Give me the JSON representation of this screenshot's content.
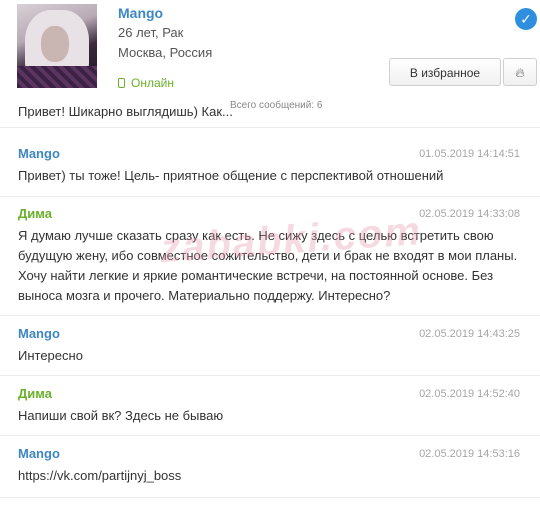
{
  "profile": {
    "name": "Mango",
    "age_sign": "26 лет, Рак",
    "location": "Москва, Россия",
    "status": "Онлайн",
    "favorite_button": "В избранное",
    "verified_icon": "check-circle-icon",
    "fire_icon": "fire-icon"
  },
  "total_messages": "Всего сообщений: 6",
  "watermark": "zababki.com",
  "first_message_partial": "Привет! Шикарно выглядишь) Как...",
  "messages": [
    {
      "author": "Mango",
      "time": "01.05.2019 14:14:51",
      "text": "Привет) ты тоже! Цель- приятное общение с перспективой отношений"
    },
    {
      "author": "Дима",
      "time": "02.05.2019 14:33:08",
      "text": "Я думаю лучше сказать сразу как есть. Не сижу здесь с целью встретить свою будущую жену, ибо совместное сожительство, дети и брак не входят в мои планы. Хочу найти легкие и яркие романтические встречи, на постоянной основе. Без выноса мозга и прочего. Материально поддержу. Интересно?"
    },
    {
      "author": "Mango",
      "time": "02.05.2019 14:43:25",
      "text": "Интересно"
    },
    {
      "author": "Дима",
      "time": "02.05.2019 14:52:40",
      "text": "Напиши свой вк? Здесь не бываю"
    },
    {
      "author": "Mango",
      "time": "02.05.2019 14:53:16",
      "text": "https://vk.com/partijnyj_boss"
    }
  ],
  "colors": {
    "mango": "#3d87c3",
    "dima": "#69b12a",
    "time": "#a6a6a6",
    "online": "#69b12a"
  }
}
